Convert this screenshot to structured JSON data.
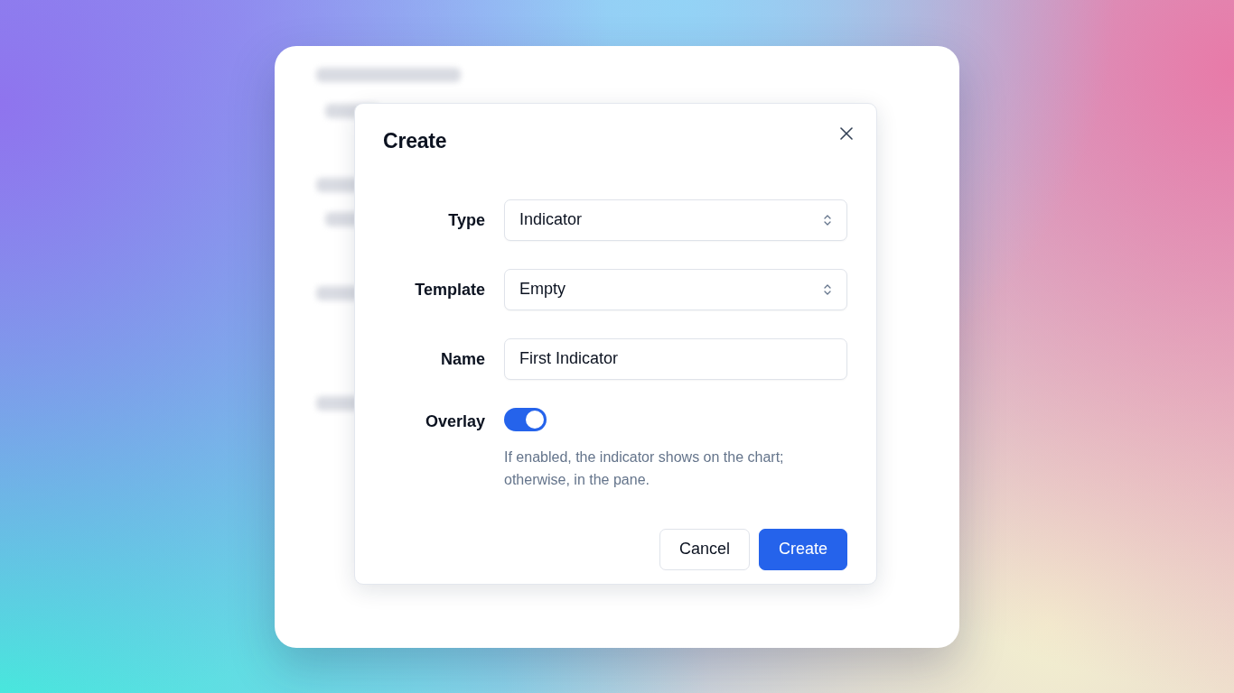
{
  "dialog": {
    "title": "Create",
    "fields": [
      {
        "kind": "select",
        "label": "Type",
        "value": "Indicator"
      },
      {
        "kind": "select",
        "label": "Template",
        "value": "Empty"
      },
      {
        "kind": "text",
        "label": "Name",
        "value": "First Indicator"
      },
      {
        "kind": "switch",
        "label": "Overlay",
        "on": true,
        "help": "If enabled, the indicator shows on the chart; otherwise, in the pane."
      }
    ],
    "buttons": [
      {
        "kind": "secondary",
        "label": "Cancel"
      },
      {
        "kind": "primary",
        "label": "Create"
      }
    ]
  }
}
